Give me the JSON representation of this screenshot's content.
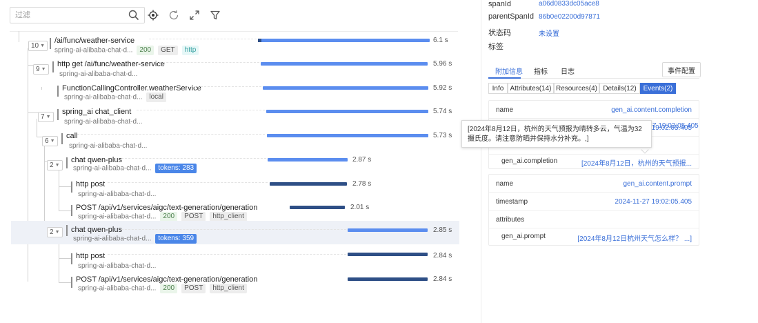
{
  "toolbar": {
    "filter_placeholder": "过滤",
    "icons": [
      "search-icon",
      "locate-icon",
      "refresh-icon",
      "expand-icon",
      "filter-icon"
    ]
  },
  "spans": [
    {
      "count": "10",
      "name": "/ai/func/weather-service",
      "service": "spring-ai-alibaba-chat-d...",
      "tags": [
        "200",
        "GET",
        "http"
      ],
      "duration": "6.1 s"
    },
    {
      "count": "9",
      "name": "http get /ai/func/weather-service",
      "service": "spring-ai-alibaba-chat-d...",
      "tags": [],
      "duration": "5.96 s"
    },
    {
      "count": "",
      "name": "FunctionCallingController.weatherService",
      "service": "spring-ai-alibaba-chat-d...",
      "tags": [
        "local"
      ],
      "duration": "5.92 s"
    },
    {
      "count": "7",
      "name": "spring_ai chat_client",
      "service": "spring-ai-alibaba-chat-d...",
      "tags": [],
      "duration": "5.74 s"
    },
    {
      "count": "6",
      "name": "call",
      "service": "spring-ai-alibaba-chat-d...",
      "tags": [],
      "duration": "5.73 s"
    },
    {
      "count": "2",
      "name": "chat qwen-plus",
      "service": "spring-ai-alibaba-chat-d...",
      "tags": [
        "tokens: 283"
      ],
      "duration": "2.87 s"
    },
    {
      "count": "",
      "name": "http post",
      "service": "spring-ai-alibaba-chat-d...",
      "tags": [],
      "duration": "2.78 s"
    },
    {
      "count": "",
      "name": "POST /api/v1/services/aigc/text-generation/generation",
      "service": "spring-ai-alibaba-chat-d...",
      "tags": [
        "200",
        "POST",
        "http_client"
      ],
      "duration": "2.01 s"
    },
    {
      "count": "2",
      "name": "chat qwen-plus",
      "service": "spring-ai-alibaba-chat-d...",
      "tags": [
        "tokens: 359"
      ],
      "duration": "2.85 s"
    },
    {
      "count": "",
      "name": "http post",
      "service": "spring-ai-alibaba-chat-d...",
      "tags": [],
      "duration": "2.84 s"
    },
    {
      "count": "",
      "name": "POST /api/v1/services/aigc/text-generation/generation",
      "service": "spring-ai-alibaba-chat-d...",
      "tags": [
        "200",
        "POST",
        "http_client"
      ],
      "duration": "2.84 s"
    }
  ],
  "details": {
    "span_id_label": "spanId",
    "span_id": "a06d0833dc05ace8",
    "parent_span_id_label": "parentSpanId",
    "parent_span_id": "86b0e02200d97871",
    "status_label": "状态码",
    "status_value": "未设置",
    "tags_label": "标签",
    "tabs": [
      "附加信息",
      "指标",
      "日志"
    ],
    "event_config": "事件配置",
    "subtabs": [
      "Info",
      "Attributes(14)",
      "Resources(4)",
      "Details(12)",
      "Events(2)"
    ]
  },
  "events": [
    {
      "name_label": "name",
      "name": "gen_ai.content.completion",
      "timestamp_label": "timestamp",
      "timestamp": "2024-11-27 19:02:05.405",
      "attributes_label": "attributes",
      "attr_key": "gen_ai.completion",
      "attr_value": "[2024年8月12日，杭州的天气预报..."
    },
    {
      "name_label": "name",
      "name": "gen_ai.content.prompt",
      "timestamp_label": "timestamp",
      "timestamp": "2024-11-27 19:02:05.405",
      "attributes_label": "attributes",
      "attr_key": "gen_ai.prompt",
      "attr_value": "[2024年8月12日杭州天气怎么样？ ...]"
    }
  ],
  "tooltip": {
    "text": "[2024年8月12日，杭州的天气预报为晴转多云，气温为32摄氏度。请注意防晒并保持水分补充。,]",
    "visible_timestamp_tail": "7 19:02:05.405"
  },
  "colors": {
    "accent": "#3a6fd8",
    "bar": "#5b8def",
    "bar_dark": "#2e4f86",
    "selected_row": "#eef1f7"
  }
}
